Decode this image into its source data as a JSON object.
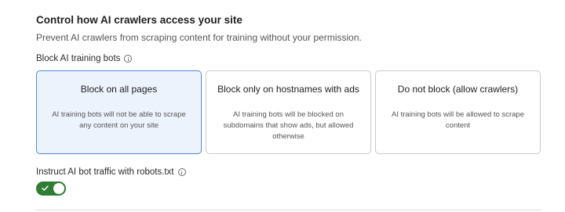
{
  "section": {
    "title": "Control how AI crawlers access your site",
    "description": "Prevent AI crawlers from scraping content for training without your permission."
  },
  "block_group": {
    "label": "Block AI training bots",
    "options": [
      {
        "title": "Block on all pages",
        "body": "AI training bots will not be able to scrape any content on your site",
        "selected": true
      },
      {
        "title": "Block only on hostnames with ads",
        "body": "AI training bots will be blocked on subdomains that show ads, but allowed otherwise",
        "selected": false
      },
      {
        "title": "Do not block (allow crawlers)",
        "body": "AI training bots will be allowed to scrape content",
        "selected": false
      }
    ]
  },
  "robots_toggle": {
    "label": "Instruct AI bot traffic with robots.txt",
    "enabled": true
  },
  "colors": {
    "selected_border": "#4a8ad8",
    "selected_background": "#edf3fc",
    "toggle_on": "#2e7d32"
  },
  "icons": {
    "info": "info-icon",
    "toggle_check": "check-icon"
  }
}
